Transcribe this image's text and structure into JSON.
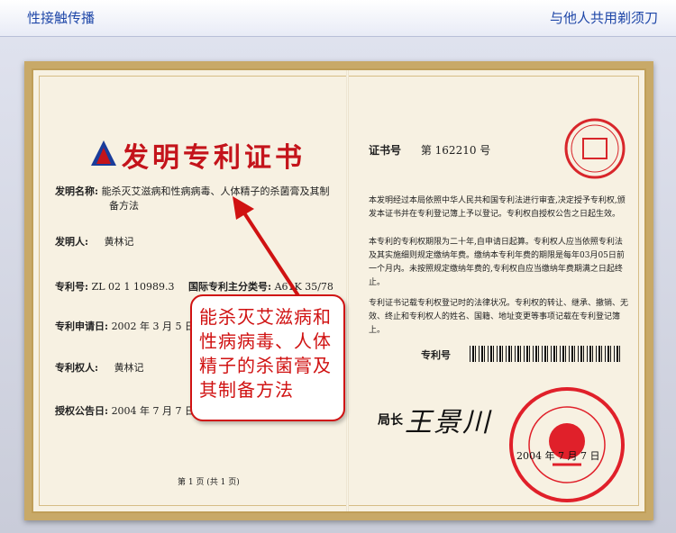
{
  "header": {
    "left_title": "性接触传播",
    "right_title": "与他人共用剃须刀"
  },
  "certificate": {
    "title": "发明专利证书",
    "invention_name_label": "发明名称:",
    "invention_name_line1": "能杀灭艾滋病和性病病毒、人体精子的杀菌膏及其制",
    "invention_name_line2": "备方法",
    "inventor_label": "发明人:",
    "inventor": "黄林记",
    "patent_no_label": "专利号:",
    "patent_no": "ZL 02 1 10989.3",
    "ipc_label": "国际专利主分类号:",
    "ipc": "A61K 35/78",
    "application_date_label": "专利申请日:",
    "application_date": "2002 年 3 月 5 日",
    "patentee_label": "专利权人:",
    "patentee": "黄林记",
    "publication_date_label": "授权公告日:",
    "publication_date": "2004 年 7 月 7 日",
    "page_indicator": "第 1 页 (共 1 页)",
    "cert_no_label": "证书号",
    "cert_no": "第 162210 号",
    "paragraph1": "本发明经过本局依照中华人民共和国专利法进行审查,决定授予专利权,颁发本证书并在专利登记簿上予以登记。专利权自授权公告之日起生效。",
    "paragraph2": "本专利的专利权期限为二十年,自申请日起算。专利权人应当依照专利法及其实施细则规定缴纳年费。缴纳本专利年费的期限是每年03月05日前一个月内。未按照规定缴纳年费的,专利权自应当缴纳年费期满之日起终止。",
    "paragraph3": "专利证书记载专利权登记时的法律状况。专利权的转让、继承、撤销、无效、终止和专利权人的姓名、国籍、地址变更等事项记载在专利登记簿上。",
    "patent_no_label_right": "专利号",
    "director_label": "局长",
    "signature": "王景川",
    "issue_date": "2004 年 7 月 7 日",
    "seal_text": "中华人民共和国国家知识产权局"
  },
  "callout": {
    "text": "能杀灭艾滋病和性病病毒、人体精子的杀菌膏及其制备方法"
  },
  "colors": {
    "title_red": "#c4141b",
    "callout_red": "#d01212",
    "header_blue": "#1f47a8",
    "frame_gold": "#c8a968"
  }
}
